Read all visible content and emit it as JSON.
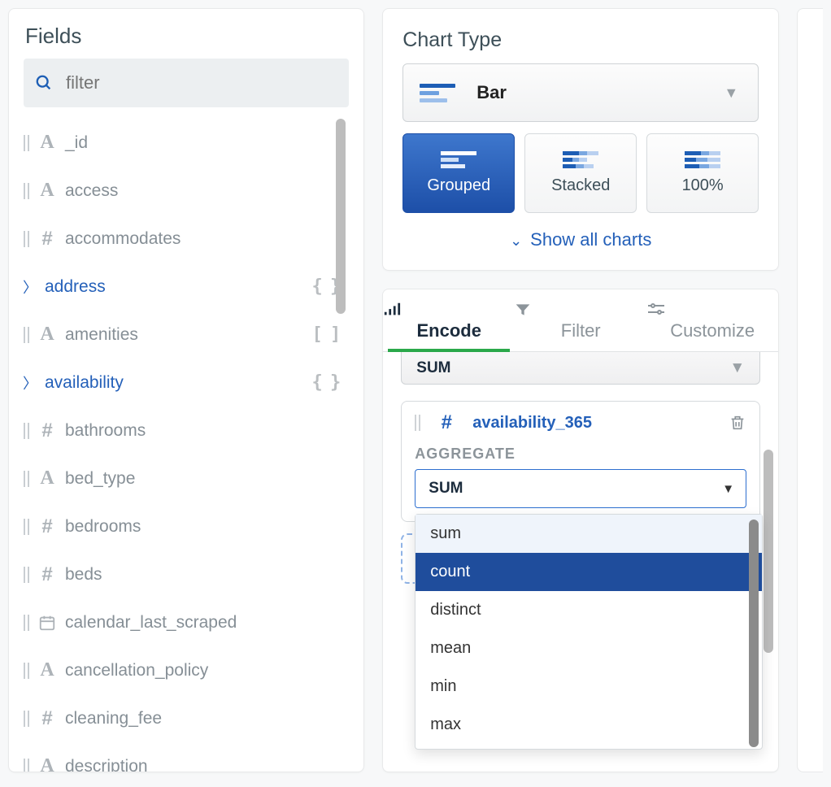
{
  "fields_panel": {
    "title": "Fields",
    "filter_placeholder": "filter",
    "items": [
      {
        "label": "_id",
        "type": "str",
        "chevron": false,
        "right": ""
      },
      {
        "label": "access",
        "type": "str",
        "chevron": false,
        "right": ""
      },
      {
        "label": "accommodates",
        "type": "num",
        "chevron": false,
        "right": ""
      },
      {
        "label": "address",
        "type": "none",
        "chevron": true,
        "right": "{}"
      },
      {
        "label": "amenities",
        "type": "str",
        "chevron": false,
        "right": "[]"
      },
      {
        "label": "availability",
        "type": "none",
        "chevron": true,
        "right": "{}"
      },
      {
        "label": "bathrooms",
        "type": "num",
        "chevron": false,
        "right": ""
      },
      {
        "label": "bed_type",
        "type": "str",
        "chevron": false,
        "right": ""
      },
      {
        "label": "bedrooms",
        "type": "num",
        "chevron": false,
        "right": ""
      },
      {
        "label": "beds",
        "type": "num",
        "chevron": false,
        "right": ""
      },
      {
        "label": "calendar_last_scraped",
        "type": "date",
        "chevron": false,
        "right": ""
      },
      {
        "label": "cancellation_policy",
        "type": "str",
        "chevron": false,
        "right": ""
      },
      {
        "label": "cleaning_fee",
        "type": "num",
        "chevron": false,
        "right": ""
      },
      {
        "label": "description",
        "type": "str",
        "chevron": false,
        "right": ""
      }
    ]
  },
  "chart_type": {
    "title": "Chart Type",
    "selected": "Bar",
    "subtypes": [
      "Grouped",
      "Stacked",
      "100%"
    ],
    "active_subtype": "Grouped",
    "show_all_label": "Show all charts"
  },
  "tabs": {
    "items": [
      "Encode",
      "Filter",
      "Customize"
    ],
    "active": "Encode"
  },
  "encode": {
    "peek_select_value": "SUM",
    "field_card": {
      "field_label": "availability_365",
      "aggregate_label": "AGGREGATE",
      "aggregate_value": "SUM"
    },
    "aggregate_options": [
      "sum",
      "count",
      "distinct",
      "mean",
      "min",
      "max"
    ],
    "aggregate_highlighted": "count",
    "aggregate_hover": "sum"
  }
}
